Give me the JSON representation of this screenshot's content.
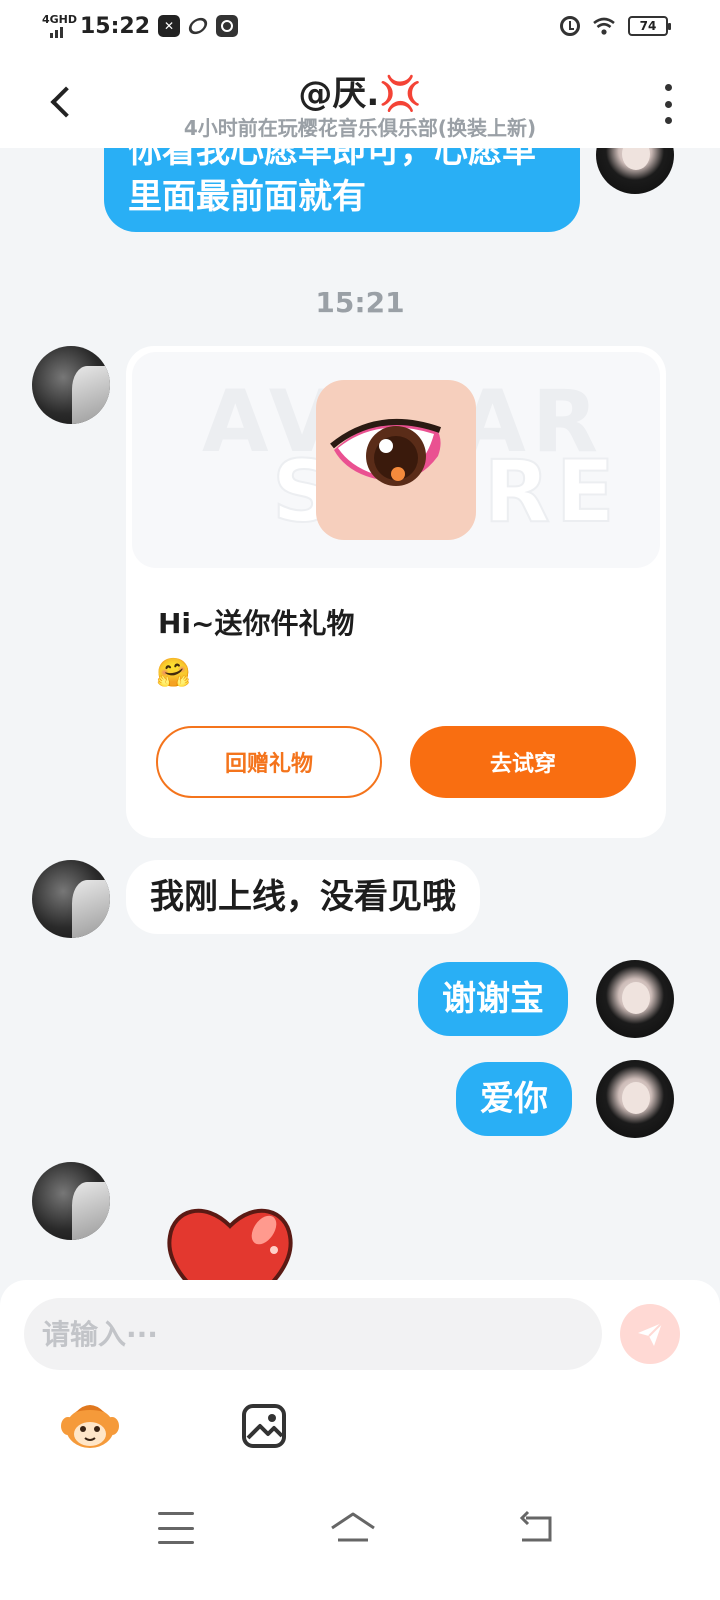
{
  "status_bar": {
    "network": "4GHD",
    "time": "15:22",
    "battery": "74"
  },
  "header": {
    "title": "@厌.",
    "angry_emoji": "💢",
    "subtitle": "4小时前在玩樱花音乐俱乐部(换装上新)"
  },
  "messages": {
    "top_bubble": "你看我心愿单即可，心愿单里面最前面就有",
    "timestamp": "15:21",
    "gift_card": {
      "watermark_line1": "AVATAR",
      "watermark_line2": "STORE",
      "title": "Hi~送你件礼物",
      "emoji": "🤗",
      "return_gift_label": "回赠礼物",
      "try_on_label": "去试穿"
    },
    "peer_reply": "我刚上线，没看见哦",
    "self_thanks": "谢谢宝",
    "self_love": "爱你"
  },
  "input": {
    "placeholder": "请输入···"
  },
  "colors": {
    "self_bubble": "#29aff5",
    "accent_orange": "#f96e11",
    "send_button": "#ffd9d4"
  }
}
